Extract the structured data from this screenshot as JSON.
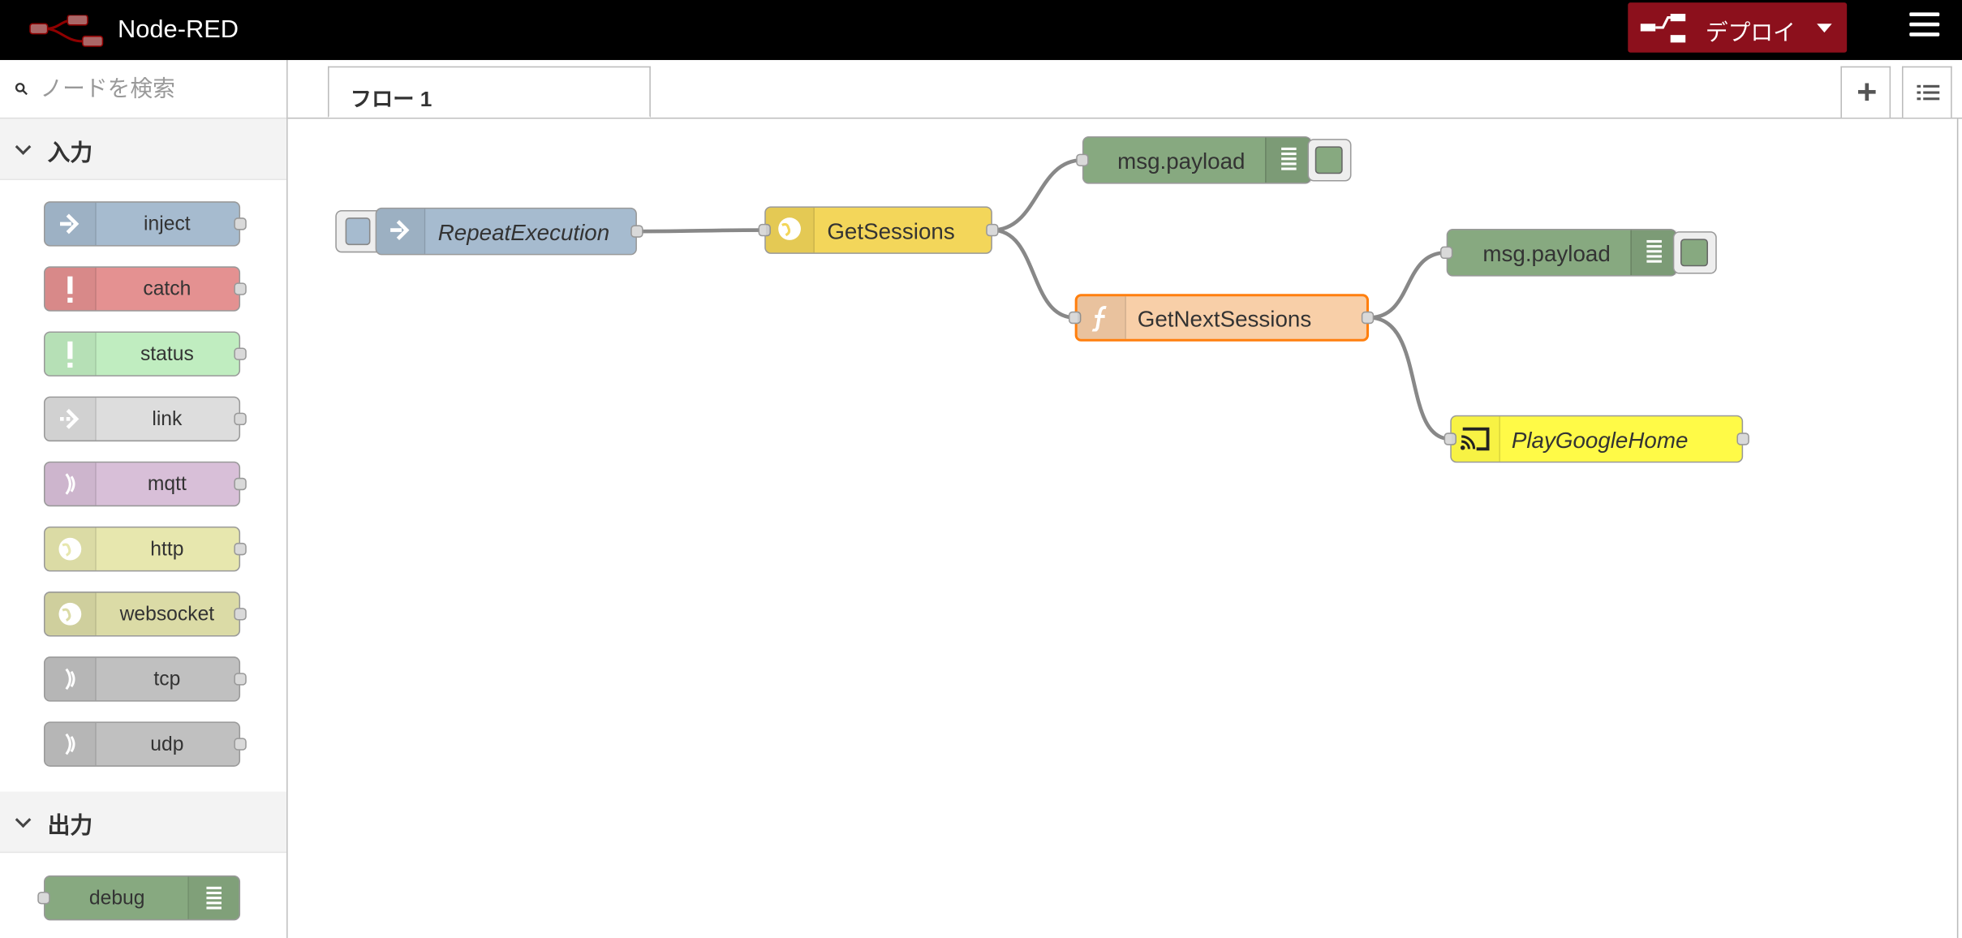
{
  "header": {
    "title": "Node-RED",
    "deploy_label": "デプロイ",
    "colors": {
      "header_bg": "#000000",
      "deploy_bg": "#8c101c"
    }
  },
  "palette": {
    "search_placeholder": "ノードを検索",
    "categories": [
      {
        "label": "入力",
        "nodes": [
          {
            "label": "inject",
            "color": "#a6bbcf",
            "icon": "arrow-in-icon"
          },
          {
            "label": "catch",
            "color": "#e49191",
            "icon": "alert-icon"
          },
          {
            "label": "status",
            "color": "#c0edc0",
            "icon": "alert-icon"
          },
          {
            "label": "link",
            "color": "#dddddd",
            "icon": "link-in-icon"
          },
          {
            "label": "mqtt",
            "color": "#d8bfd8",
            "icon": "bridge-icon"
          },
          {
            "label": "http",
            "color": "#e7e7ae",
            "icon": "globe-icon"
          },
          {
            "label": "websocket",
            "color": "#dbdba6",
            "icon": "globe-icon"
          },
          {
            "label": "tcp",
            "color": "#c0c0c0",
            "icon": "bridge-icon"
          },
          {
            "label": "udp",
            "color": "#c0c0c0",
            "icon": "bridge-icon"
          }
        ]
      },
      {
        "label": "出力",
        "nodes": [
          {
            "label": "debug",
            "color": "#87a980",
            "icon": "debug-icon"
          }
        ]
      }
    ]
  },
  "workspace": {
    "tab_label": "フロー 1",
    "nodes": [
      {
        "label": "RepeatExecution",
        "color": "#a6bbcf",
        "icon": "arrow-in-icon",
        "type": "inject"
      },
      {
        "label": "GetSessions",
        "color": "#f3d65a",
        "icon": "globe-icon",
        "type": "http request"
      },
      {
        "label": "msg.payload",
        "color": "#87a980",
        "icon": "debug-icon",
        "type": "debug"
      },
      {
        "label": "GetNextSessions",
        "color": "#f8cfa8",
        "icon": "function-icon",
        "type": "function"
      },
      {
        "label": "msg.payload",
        "color": "#87a980",
        "icon": "debug-icon",
        "type": "debug"
      },
      {
        "label": "PlayGoogleHome",
        "color": "#fffa47",
        "icon": "cast-icon",
        "type": "google home"
      }
    ]
  }
}
